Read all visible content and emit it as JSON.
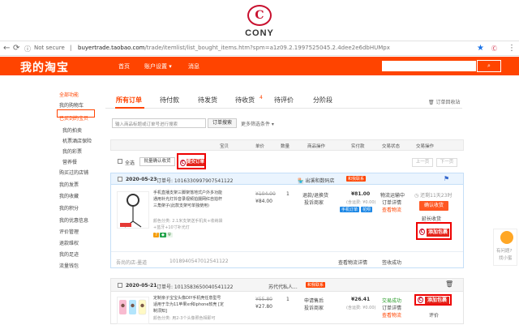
{
  "brand_logo": {
    "mark": "C",
    "text": "CONY"
  },
  "address_bar": {
    "security": "Not secure",
    "divider": "|",
    "host": "buyertrade.taobao.com",
    "path": "/trade/itemlist/list_bought_items.htm?spm=a1z09.2.1997525045.2.4dee2e6dbHUMpx"
  },
  "topnav": {
    "brand": "我的淘宝",
    "items": [
      "首页",
      "账户设置 ▾",
      "消息"
    ]
  },
  "sidebar": {
    "items": [
      {
        "label": "全部功能",
        "red": true,
        "indent": false
      },
      {
        "label": "我的购物车",
        "red": false,
        "indent": false
      },
      {
        "label": "已买到的宝贝",
        "red": true,
        "indent": false
      },
      {
        "label": "我的拍卖",
        "red": false,
        "indent": true
      },
      {
        "label": "机票酒店保险",
        "red": false,
        "indent": true
      },
      {
        "label": "我的彩票",
        "red": false,
        "indent": true
      },
      {
        "label": "营养餐",
        "red": false,
        "indent": true
      },
      {
        "label": "购买过的店铺",
        "red": false,
        "indent": false
      },
      {
        "label": "我的发票",
        "red": false,
        "indent": false
      },
      {
        "label": "我的收藏",
        "red": false,
        "indent": false
      },
      {
        "label": "我的积分",
        "red": false,
        "indent": false
      },
      {
        "label": "我的优惠信息",
        "red": false,
        "indent": false
      },
      {
        "label": "评价管理",
        "red": false,
        "indent": false
      },
      {
        "label": "退款维权",
        "red": false,
        "indent": false
      },
      {
        "label": "我的足迹",
        "red": false,
        "indent": false
      },
      {
        "label": "流量钱包",
        "red": false,
        "indent": false
      }
    ]
  },
  "tabs": {
    "items": [
      "所有订单",
      "待付款",
      "待发货",
      "待收货",
      "待评价",
      "分阶段"
    ],
    "badge": "4",
    "recycle": "订单回收站"
  },
  "search": {
    "placeholder": "输入商品标题或订单号进行搜索",
    "button": "订单搜索",
    "more": "更多筛选条件 ▾"
  },
  "columns": [
    "宝贝",
    "单价",
    "数量",
    "商品操作",
    "实付款",
    "交易状态",
    "交易操作"
  ],
  "bulk": {
    "select_all": "全选",
    "batch_confirm": "批量确认收货",
    "submit_order": "提交订单",
    "prev": "上一页",
    "next": "下一页"
  },
  "order1": {
    "date": "2020-05-23",
    "order_label": "订单号: 1016330997907541122",
    "shop": "出溪和数码店",
    "contact": "和我联系",
    "title": "手机直播支架三脚架落地式户外多功能通用补光灯抖音录视频拍摄网红自拍杆三角架子(此款支架可单独使用)",
    "spec": "颜色分类: 2.1米支架送手机夹+收纳袋+蓝牙+10寸补光灯",
    "price_orig": "¥104.00",
    "price_now": "¥84.00",
    "qty": "1",
    "ops": [
      "退款/退换货",
      "投诉商家"
    ],
    "total": "¥81.00",
    "shipping": "(含运费: ¥0.00)",
    "tags": [
      "手机订单",
      "花呗"
    ],
    "status": [
      "物流运输中",
      "订单详情",
      "查看物流"
    ],
    "countdown": "还剩11天23时",
    "confirm": "确认收货",
    "extend": "延长收货",
    "add_pkg": "添加包裹",
    "footer_left": "吾尚的店-墨道",
    "footer_no": "1018940547012541122",
    "footer_status": "查看物流详情",
    "footer_op": "签收成功"
  },
  "order2": {
    "date": "2020-05-21",
    "order_label": "订单号: 1013583650040541122",
    "shop": "苏代代私人...",
    "contact": "和我联系",
    "title": "定制亲子宝宝头像DIY手机壳任意型号适用于华为11苹果xr和iphone软壳 [定制须知]",
    "spec": "颜色分类: 用2-3个头像照色相即可",
    "price_orig": "¥55.80",
    "price_now": "¥27.80",
    "qty": "1",
    "ops": [
      "申请售后",
      "投诉商家"
    ],
    "total": "¥26.41",
    "shipping": "(含运费: ¥0.00)",
    "status": [
      "交易成功",
      "订单详情",
      "查看物流"
    ],
    "add_pkg": "添加包裹",
    "review": "评价"
  },
  "float_help": {
    "line1": "有问题?",
    "line2": "找小蜜"
  },
  "colors": {
    "accent": "#ff4400",
    "highlight": "#e4231a"
  }
}
